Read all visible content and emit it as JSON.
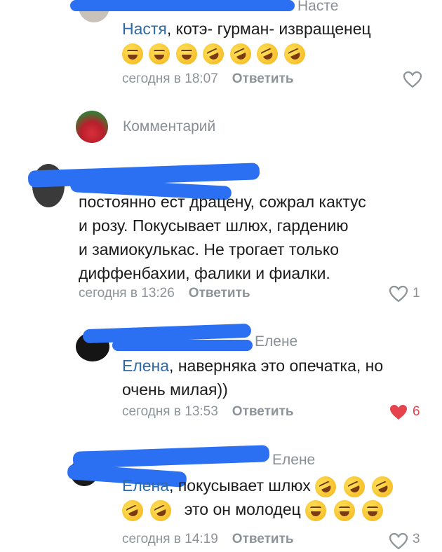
{
  "comment1": {
    "reply_to": "Насте",
    "name": "Настя",
    "text": ", котэ- гурман- извращенец",
    "time": "сегодня в 18:07",
    "reply_label": "Ответить"
  },
  "composer": {
    "placeholder": "Комментарий"
  },
  "comment2": {
    "lines": [
      "постоянно ест драцену, сожрал кактус",
      "и розу. Покусывает шлюх, гардению",
      "и замиокулькас.  Не трогает только",
      "диффенбахии, фалики и фиалки."
    ],
    "time": "сегодня в 13:26",
    "reply_label": "Ответить",
    "likes": "1"
  },
  "comment3": {
    "reply_to": "Елене",
    "name": "Елена",
    "text_line1": ", наверняка это опечатка, но",
    "text_line2": "очень милая))",
    "time": "сегодня в 13:53",
    "reply_label": "Ответить",
    "likes": "6",
    "like_color": "#e5444d"
  },
  "comment4": {
    "reply_to": "Елене",
    "name": "Елена",
    "text_line1": ", покусывает шлюх",
    "text_line2": "это он молодец",
    "time": "сегодня в 14:19",
    "reply_label": "Ответить",
    "likes": "3"
  },
  "colors": {
    "link": "#2f6aa8",
    "meta": "#8d9399",
    "scribble": "#2b6ff2"
  }
}
